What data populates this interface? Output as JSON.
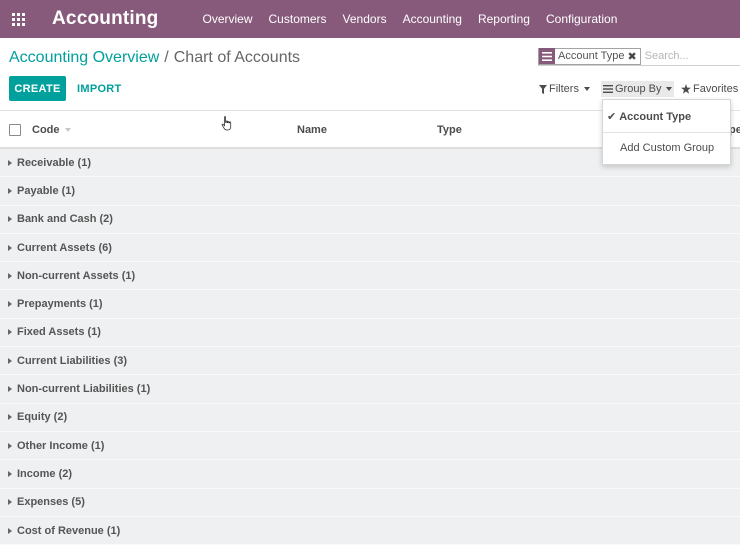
{
  "navbar": {
    "apps_icon": "apps-grid-icon",
    "app_title": "Accounting",
    "menu": [
      "Overview",
      "Customers",
      "Vendors",
      "Accounting",
      "Reporting",
      "Configuration"
    ]
  },
  "breadcrumb": {
    "parent": "Accounting Overview",
    "separator": "/",
    "current": "Chart of Accounts"
  },
  "search": {
    "facet_icon": "group-by-list-icon",
    "facet_value": "Account Type",
    "remove_icon": "close-icon",
    "placeholder": "Search..."
  },
  "buttons": {
    "create": "CREATE",
    "import": "IMPORT"
  },
  "filter_bar": {
    "filters": "Filters",
    "group_by": "Group By",
    "favorites": "Favorites"
  },
  "group_by_dropdown": {
    "selected_item": "Account Type",
    "custom_group": "Add Custom Group"
  },
  "list": {
    "columns": [
      "Code",
      "Name",
      "Type",
      "pe"
    ],
    "groups": [
      "Receivable (1)",
      "Payable (1)",
      "Bank and Cash (2)",
      "Current Assets (6)",
      "Non-current Assets (1)",
      "Prepayments (1)",
      "Fixed Assets (1)",
      "Current Liabilities (3)",
      "Non-current Liabilities (1)",
      "Equity (2)",
      "Other Income (1)",
      "Income (2)",
      "Expenses (5)",
      "Cost of Revenue (1)"
    ]
  },
  "colors": {
    "navbar": "#875a7b",
    "accent": "#00a09d",
    "group_row": "#eef0f1"
  }
}
